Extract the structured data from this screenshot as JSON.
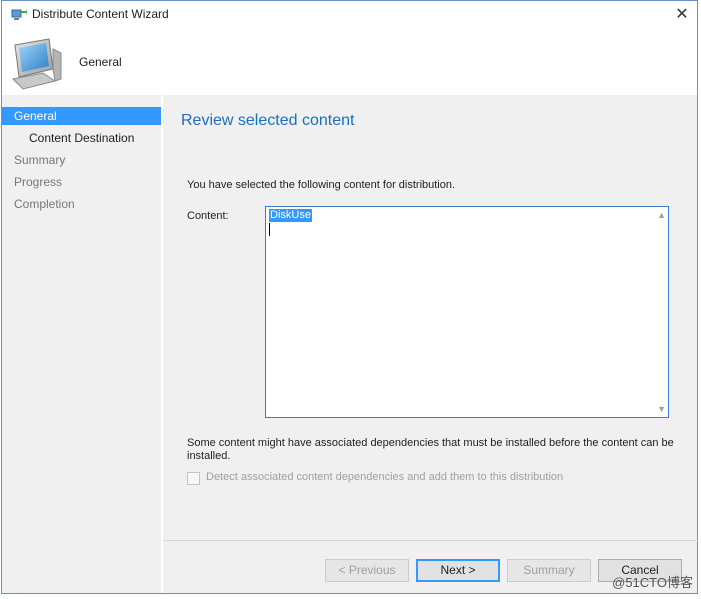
{
  "window": {
    "title": "Distribute Content Wizard",
    "close_glyph": "✕"
  },
  "header": {
    "title": "General",
    "icon": "computer-monitor-icon"
  },
  "sidebar": {
    "items": [
      {
        "label": "General",
        "state": "active"
      },
      {
        "label": "Content Destination",
        "state": "current"
      },
      {
        "label": "Summary",
        "state": "inactive"
      },
      {
        "label": "Progress",
        "state": "inactive"
      },
      {
        "label": "Completion",
        "state": "inactive"
      }
    ]
  },
  "main": {
    "heading": "Review selected content",
    "intro": "You have selected the following content for distribution.",
    "content_label": "Content:",
    "content_value": "DiskUse",
    "dependency_note": "Some content might have associated dependencies that must be installed before the content can be installed.",
    "checkbox_label": "Detect associated content dependencies and add them to this distribution",
    "checkbox_checked": false
  },
  "buttons": {
    "previous": "< Previous",
    "next": "Next >",
    "summary": "Summary",
    "cancel": "Cancel"
  },
  "watermark": "@51CTO博客",
  "colors": {
    "accent": "#3399ff",
    "heading": "#1b6ec2",
    "border": "#6c8fc0"
  }
}
